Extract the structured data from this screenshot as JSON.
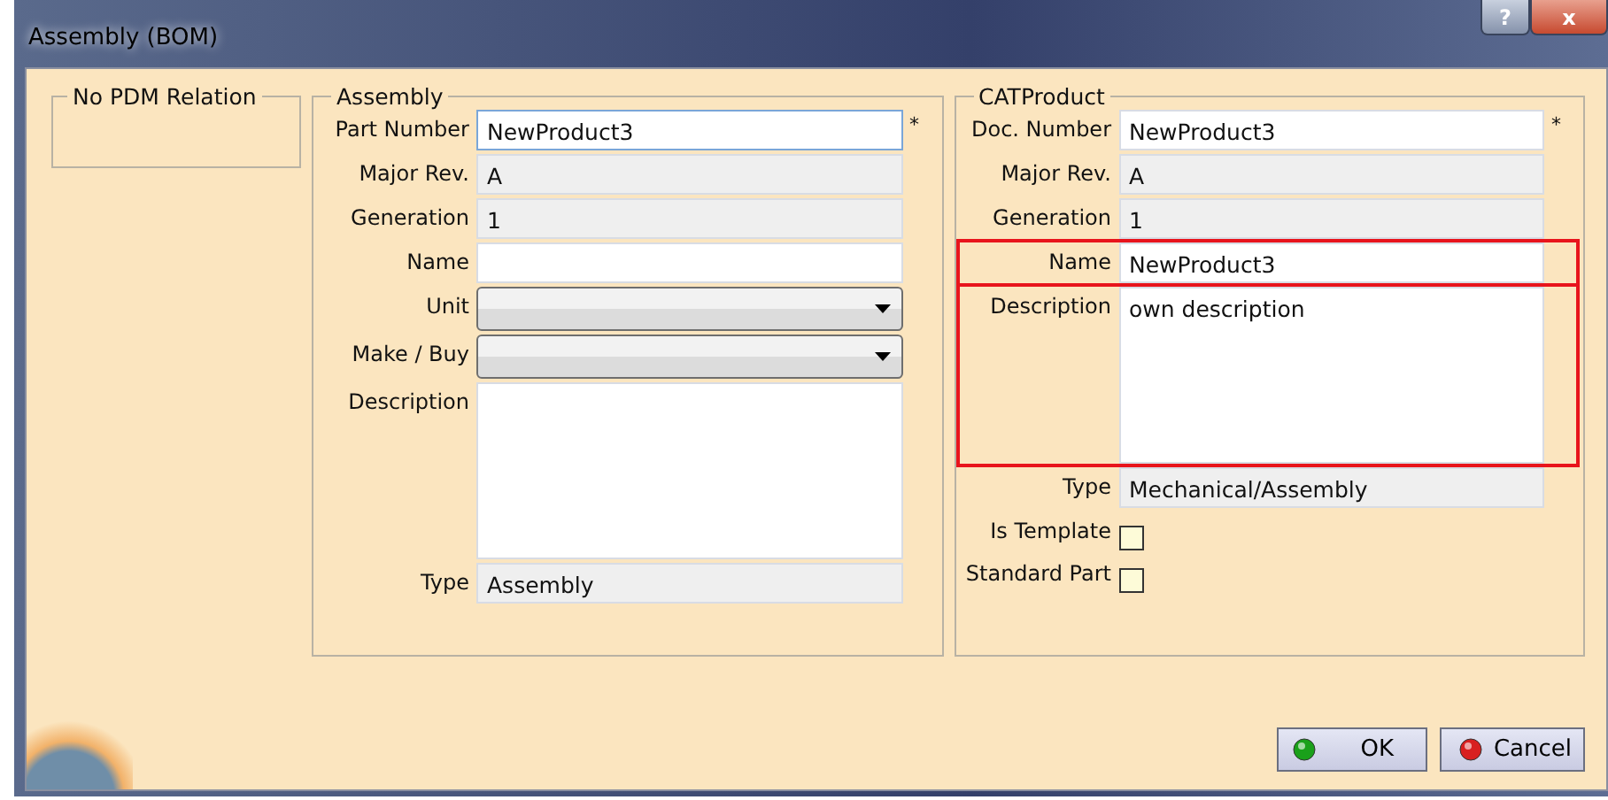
{
  "window": {
    "title": "Assembly (BOM)",
    "controls": [
      {
        "kind": "help",
        "label": "?"
      },
      {
        "kind": "close",
        "label": "x"
      }
    ]
  },
  "groups": [
    {
      "title": "No PDM Relation",
      "kind": "empty"
    },
    {
      "title": "Assembly",
      "kind": "form",
      "fields": [
        {
          "label": "Part Number",
          "kind": "text",
          "value": "NewProduct3",
          "required": "*",
          "focused": true,
          "highlighted": false
        },
        {
          "label": "Major Rev.",
          "kind": "readonly",
          "value": "A",
          "highlighted": false
        },
        {
          "label": "Generation",
          "kind": "readonly",
          "value": "1",
          "highlighted": false
        },
        {
          "label": "Name",
          "kind": "text",
          "highlighted": false
        },
        {
          "label": "Unit",
          "kind": "dropdown",
          "highlighted": false
        },
        {
          "label": "Make / Buy",
          "kind": "dropdown",
          "highlighted": false
        },
        {
          "label": "Description",
          "kind": "textarea",
          "highlighted": false
        },
        {
          "label": "Type",
          "kind": "readonly",
          "value": "Assembly",
          "highlighted": false
        }
      ]
    },
    {
      "title": "CATProduct",
      "kind": "form",
      "fields": [
        {
          "label": "Doc. Number",
          "kind": "text",
          "value": "NewProduct3",
          "required": "*",
          "focused": false,
          "highlighted": false
        },
        {
          "label": "Major Rev.",
          "kind": "readonly",
          "value": "A",
          "highlighted": false
        },
        {
          "label": "Generation",
          "kind": "readonly",
          "value": "1",
          "highlighted": false
        },
        {
          "label": "Name",
          "kind": "text",
          "value": "NewProduct3",
          "highlighted": true
        },
        {
          "label": "Description",
          "kind": "textarea",
          "value": "own description",
          "highlighted": true
        },
        {
          "label": "Type",
          "kind": "readonly",
          "value": "Mechanical/Assembly",
          "highlighted": false
        },
        {
          "label": "Is Template",
          "kind": "checkbox",
          "checked": false,
          "highlighted": false
        },
        {
          "label": "Standard Part",
          "kind": "checkbox",
          "checked": false,
          "highlighted": false
        }
      ]
    }
  ],
  "buttons": [
    {
      "label": "OK",
      "kind": "ok"
    },
    {
      "label": "Cancel",
      "kind": "cancel"
    }
  ]
}
